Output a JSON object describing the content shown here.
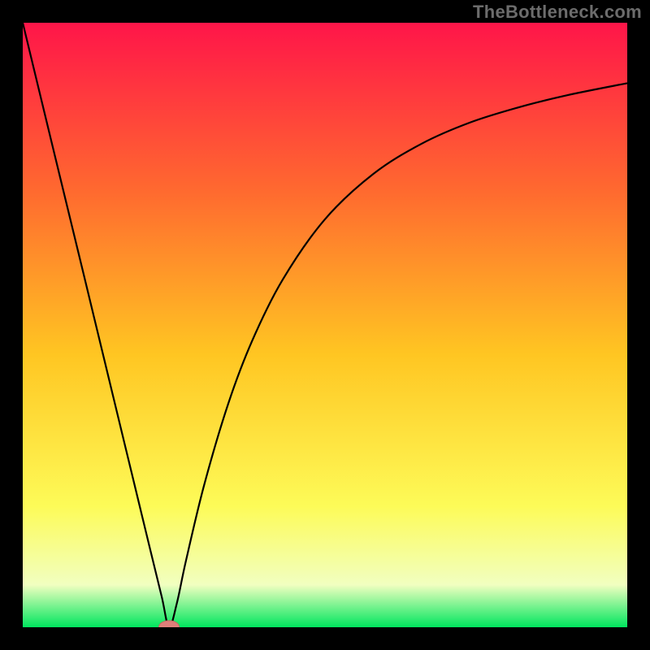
{
  "watermark": "TheBottleneck.com",
  "colors": {
    "bg": "#000000",
    "curve": "#000000",
    "marker_fill": "#df7f7a",
    "marker_stroke": "#c86761",
    "grad_top": "#ff1549",
    "grad_upper": "#ff6a2f",
    "grad_mid": "#ffc622",
    "grad_lower": "#fdfb58",
    "grad_pale": "#f1ffc0",
    "grad_green": "#00e65e"
  },
  "chart_data": {
    "type": "line",
    "title": "",
    "xlabel": "",
    "ylabel": "",
    "xlim": [
      0,
      100
    ],
    "ylim": [
      0,
      100
    ],
    "grid": false,
    "marker": {
      "x": 24.2,
      "y": 0,
      "rx": 1.7,
      "ry": 1.1
    },
    "series": [
      {
        "name": "curve",
        "x": [
          0,
          5,
          10,
          15,
          18,
          21,
          23,
          24.2,
          25.5,
          27,
          30,
          34,
          38,
          43,
          50,
          58,
          66,
          74,
          82,
          90,
          100
        ],
        "values": [
          100,
          79.3,
          58.7,
          38.0,
          25.6,
          13.2,
          5.0,
          0,
          4.0,
          11.0,
          23.5,
          37.0,
          47.5,
          57.5,
          67.5,
          75.0,
          80.0,
          83.5,
          86.0,
          88.0,
          90.0
        ]
      }
    ]
  }
}
